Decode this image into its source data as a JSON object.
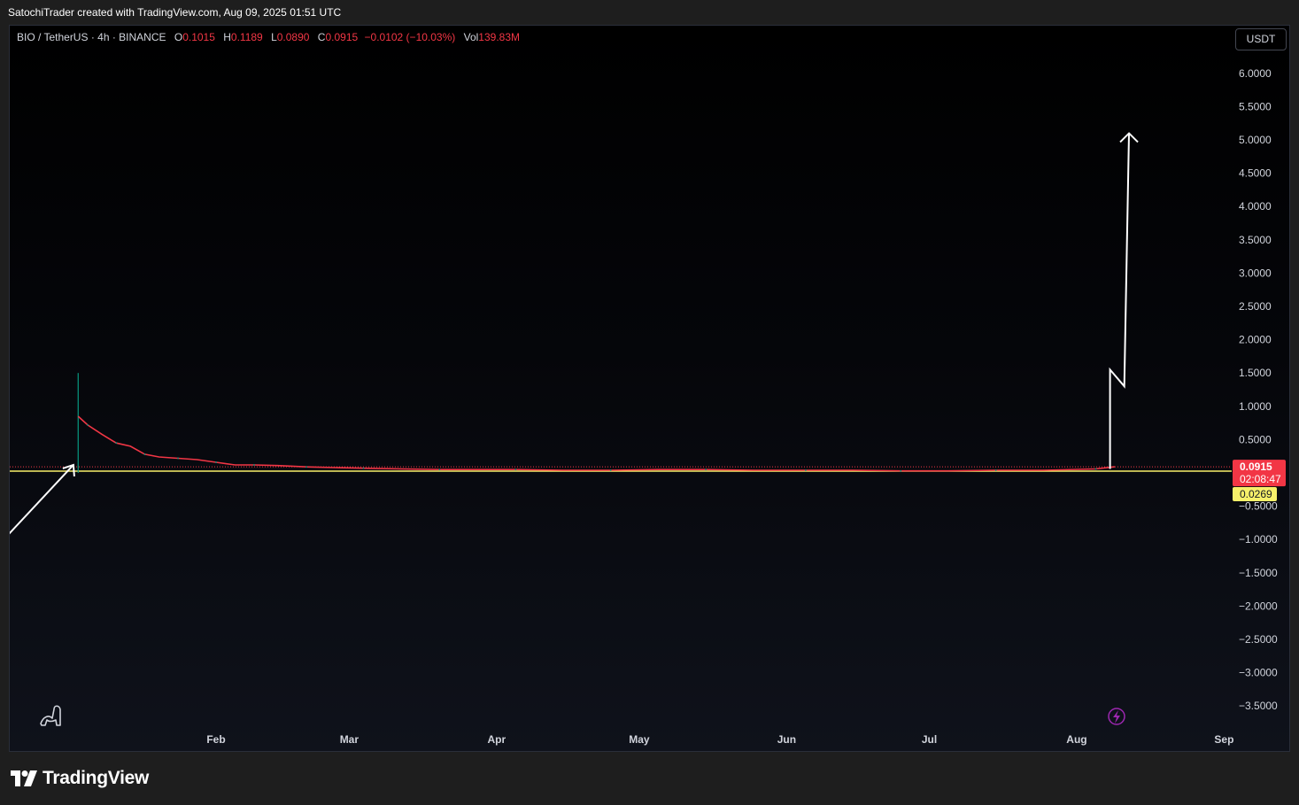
{
  "header": {
    "credit": "SatochiTrader created with TradingView.com, Aug 09, 2025 01:51 UTC"
  },
  "legend": {
    "symbol": "BIO / TetherUS · 4h · BINANCE",
    "o_label": "O",
    "o_value": "0.1015",
    "h_label": "H",
    "h_value": "0.1189",
    "l_label": "L",
    "l_value": "0.0890",
    "c_label": "C",
    "c_value": "0.0915",
    "change": "−0.0102 (−10.03%)",
    "vol_label": "Vol",
    "vol_value": "139.83M"
  },
  "currency_button": "USDT",
  "price_badge": {
    "price": "0.0915",
    "countdown": "02:08:47"
  },
  "level_badge": "0.0269",
  "footer": {
    "brand": "TradingView"
  },
  "colors": {
    "down": "#f23645",
    "up": "#089981",
    "level": "#f7f06a",
    "axis_text": "#d1d4dc",
    "arrow": "#ffffff",
    "lightning": "#9c27b0"
  },
  "icons": [
    "dino-icon",
    "lightning-icon",
    "tradingview-logo-icon"
  ],
  "chart_data": {
    "type": "line",
    "ylim": [
      -3.9,
      6.5
    ],
    "yticks": [
      "6.0000",
      "5.5000",
      "5.0000",
      "4.5000",
      "4.0000",
      "3.5000",
      "3.0000",
      "2.5000",
      "2.0000",
      "1.5000",
      "1.0000",
      "0.5000",
      "−0.5000",
      "−1.0000",
      "−1.5000",
      "−2.0000",
      "−2.5000",
      "−3.0000",
      "−3.5000"
    ],
    "ytick_values": [
      6.0,
      5.5,
      5.0,
      4.5,
      4.0,
      3.5,
      3.0,
      2.5,
      2.0,
      1.5,
      1.0,
      0.5,
      -0.5,
      -1.0,
      -1.5,
      -2.0,
      -2.5,
      -3.0,
      -3.5
    ],
    "x_months": [
      "Feb",
      "Mar",
      "Apr",
      "May",
      "Jun",
      "Jul",
      "Aug",
      "Sep"
    ],
    "x_month_dates": [
      "2025-02-01",
      "2025-03-01",
      "2025-04-01",
      "2025-05-01",
      "2025-06-01",
      "2025-07-01",
      "2025-08-01",
      "2025-09-01"
    ],
    "listing_spike": {
      "date": "2025-01-03",
      "high": 1.5
    },
    "series": [
      {
        "dates": [
          "2025-01-03",
          "2025-01-05",
          "2025-01-08",
          "2025-01-11",
          "2025-01-14",
          "2025-01-17",
          "2025-01-20",
          "2025-01-24",
          "2025-01-28",
          "2025-02-01",
          "2025-02-05",
          "2025-02-09",
          "2025-02-14",
          "2025-02-20",
          "2025-02-26",
          "2025-03-04",
          "2025-03-12",
          "2025-03-20",
          "2025-03-28",
          "2025-04-05",
          "2025-04-15",
          "2025-04-25",
          "2025-05-05",
          "2025-05-15",
          "2025-05-25",
          "2025-06-05",
          "2025-06-15",
          "2025-06-25",
          "2025-07-05",
          "2025-07-15",
          "2025-07-25",
          "2025-08-05",
          "2025-08-09"
        ],
        "values": [
          0.85,
          0.72,
          0.58,
          0.45,
          0.4,
          0.28,
          0.24,
          0.22,
          0.2,
          0.16,
          0.12,
          0.12,
          0.11,
          0.09,
          0.08,
          0.07,
          0.06,
          0.05,
          0.05,
          0.05,
          0.04,
          0.04,
          0.05,
          0.05,
          0.04,
          0.04,
          0.04,
          0.03,
          0.03,
          0.04,
          0.04,
          0.06,
          0.0915
        ]
      }
    ],
    "horizontal_levels": [
      0.0269,
      0.0915
    ],
    "annotations": [
      {
        "type": "arrow",
        "from": [
          "2024-12-19",
          -0.95
        ],
        "to": [
          "2025-01-02",
          0.12
        ]
      },
      {
        "type": "zigzag-arrow",
        "points": [
          [
            "2025-08-08",
            0.06
          ],
          [
            "2025-08-08",
            1.55
          ],
          [
            "2025-08-11",
            1.3
          ],
          [
            "2025-08-12",
            5.1
          ]
        ]
      }
    ]
  }
}
